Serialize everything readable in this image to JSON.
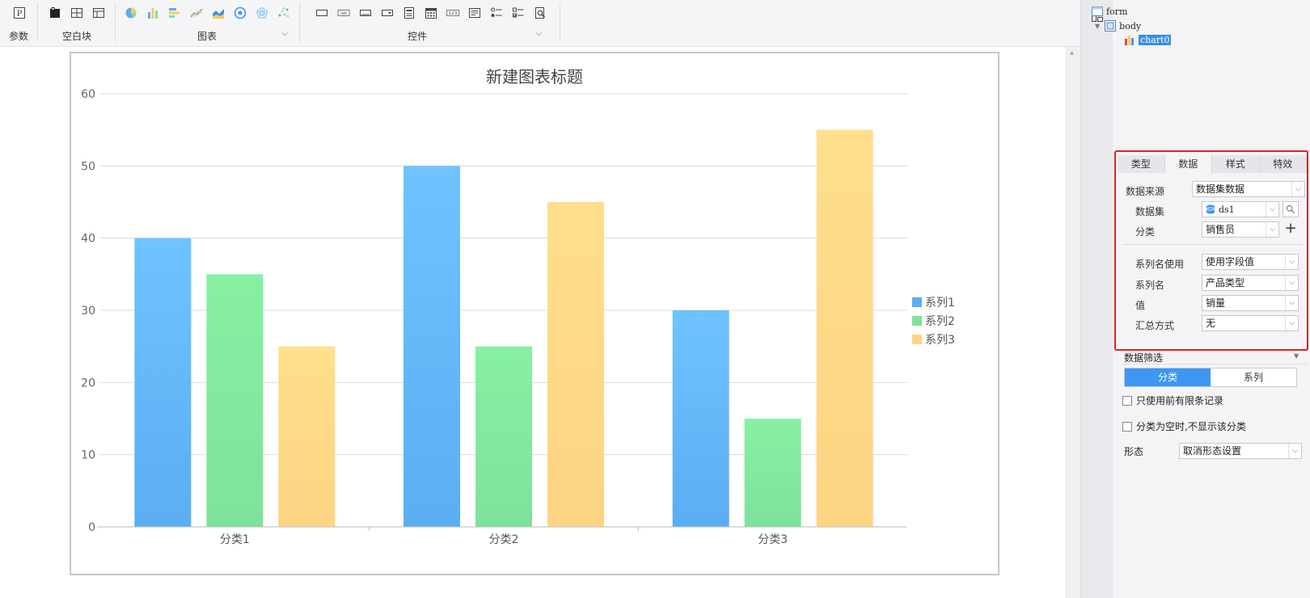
{
  "toolbar": {
    "groups": [
      {
        "label": "参数"
      },
      {
        "label": "空白块"
      },
      {
        "label": "图表"
      },
      {
        "label": "控件"
      }
    ]
  },
  "tree": {
    "nodes": [
      {
        "label": "form"
      },
      {
        "label": "body"
      },
      {
        "label": "chart0"
      }
    ]
  },
  "panel": {
    "tabs": [
      "类型",
      "数据",
      "样式",
      "特效"
    ],
    "active_tab": "数据",
    "data_source": {
      "label": "数据来源",
      "value": "数据集数据"
    },
    "dataset": {
      "label": "数据集",
      "value": "ds1"
    },
    "category": {
      "label": "分类",
      "value": "销售员"
    },
    "series_name_use": {
      "label": "系列名使用",
      "value": "使用字段值"
    },
    "series_name": {
      "label": "系列名",
      "value": "产品类型"
    },
    "value": {
      "label": "值",
      "value": "销量"
    },
    "summary": {
      "label": "汇总方式",
      "value": "无"
    },
    "filter": {
      "title": "数据筛选",
      "seg_options": [
        "分类",
        "系列"
      ],
      "seg_active": "分类",
      "checkbox1": "只使用前有限条记录",
      "checkbox2": "分类为空时,不显示该分类",
      "form_label": "形态",
      "form_value": "取消形态设置"
    }
  },
  "colors": {
    "series1": "#5aaef2",
    "series2": "#7fe29b",
    "series3": "#fcd482",
    "highlight": "#e02020",
    "accent": "#3d97f3"
  },
  "chart_data": {
    "type": "bar",
    "title": "新建图表标题",
    "categories": [
      "分类1",
      "分类2",
      "分类3"
    ],
    "series": [
      {
        "name": "系列1",
        "values": [
          40,
          50,
          30
        ]
      },
      {
        "name": "系列2",
        "values": [
          35,
          25,
          15
        ]
      },
      {
        "name": "系列3",
        "values": [
          25,
          45,
          55
        ]
      }
    ],
    "yticks": [
      "0",
      "10",
      "20",
      "30",
      "40",
      "50",
      "60"
    ],
    "ylim": [
      0,
      60
    ],
    "grid": true,
    "legend": "right"
  }
}
